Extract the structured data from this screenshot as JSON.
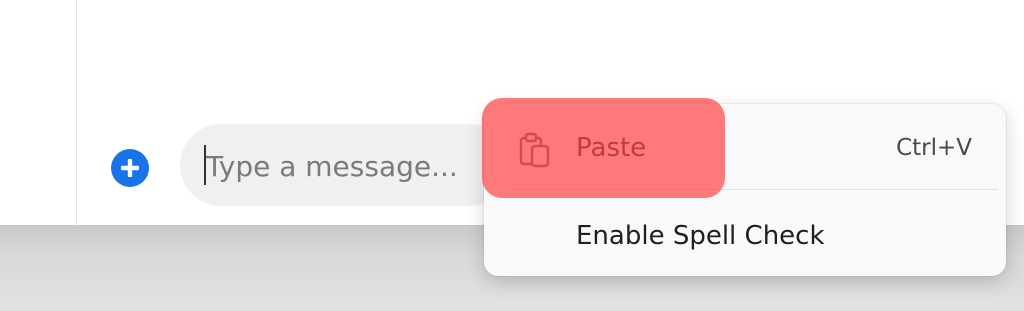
{
  "composer": {
    "placeholder": "Type a message...",
    "value": ""
  },
  "context_menu": {
    "items": [
      {
        "label": "Paste",
        "shortcut": "Ctrl+V",
        "icon": "clipboard-icon"
      },
      {
        "label": "Enable Spell Check",
        "shortcut": ""
      }
    ]
  },
  "colors": {
    "add_button": "#1a73e8",
    "highlight": "#ff4646"
  }
}
